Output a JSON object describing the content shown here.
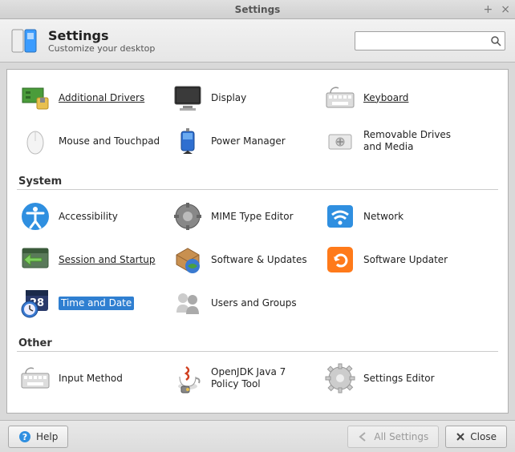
{
  "window": {
    "title": "Settings"
  },
  "header": {
    "title": "Settings",
    "subtitle": "Customize your desktop"
  },
  "search": {
    "placeholder": ""
  },
  "categories": [
    {
      "id": "hardware",
      "label": "",
      "items": [
        {
          "label": "Additional Drivers",
          "icon": "drivers",
          "underlined": true
        },
        {
          "label": "Display",
          "icon": "display"
        },
        {
          "label": "Keyboard",
          "icon": "keyboard",
          "underlined": true
        },
        {
          "label": "Mouse and Touchpad",
          "icon": "mouse"
        },
        {
          "label": "Power Manager",
          "icon": "power"
        },
        {
          "label": "Removable Drives and Media",
          "icon": "removable"
        }
      ]
    },
    {
      "id": "system",
      "label": "System",
      "items": [
        {
          "label": "Accessibility",
          "icon": "accessibility"
        },
        {
          "label": "MIME Type Editor",
          "icon": "mime"
        },
        {
          "label": "Network",
          "icon": "network"
        },
        {
          "label": "Session and Startup",
          "icon": "session",
          "underlined": true
        },
        {
          "label": "Software & Updates",
          "icon": "software"
        },
        {
          "label": "Software Updater",
          "icon": "updater"
        },
        {
          "label": "Time and Date",
          "icon": "timedate",
          "selected": true
        },
        {
          "label": "Users and Groups",
          "icon": "users"
        }
      ]
    },
    {
      "id": "other",
      "label": "Other",
      "items": [
        {
          "label": "Input Method",
          "icon": "keyboard2"
        },
        {
          "label": "OpenJDK Java 7 Policy Tool",
          "icon": "java"
        },
        {
          "label": "Settings Editor",
          "icon": "gear"
        }
      ]
    }
  ],
  "footer": {
    "help": "Help",
    "all_settings": "All Settings",
    "close": "Close"
  },
  "icons": {
    "drivers": "drivers-icon",
    "display": "display-icon",
    "keyboard": "keyboard-icon",
    "mouse": "mouse-icon",
    "power": "power-icon",
    "removable": "removable-icon",
    "accessibility": "accessibility-icon",
    "mime": "mime-icon",
    "network": "network-icon",
    "session": "session-icon",
    "software": "software-icon",
    "updater": "updater-icon",
    "timedate": "timedate-icon",
    "users": "users-icon",
    "keyboard2": "keyboard-icon",
    "java": "java-icon",
    "gear": "gear-icon"
  }
}
